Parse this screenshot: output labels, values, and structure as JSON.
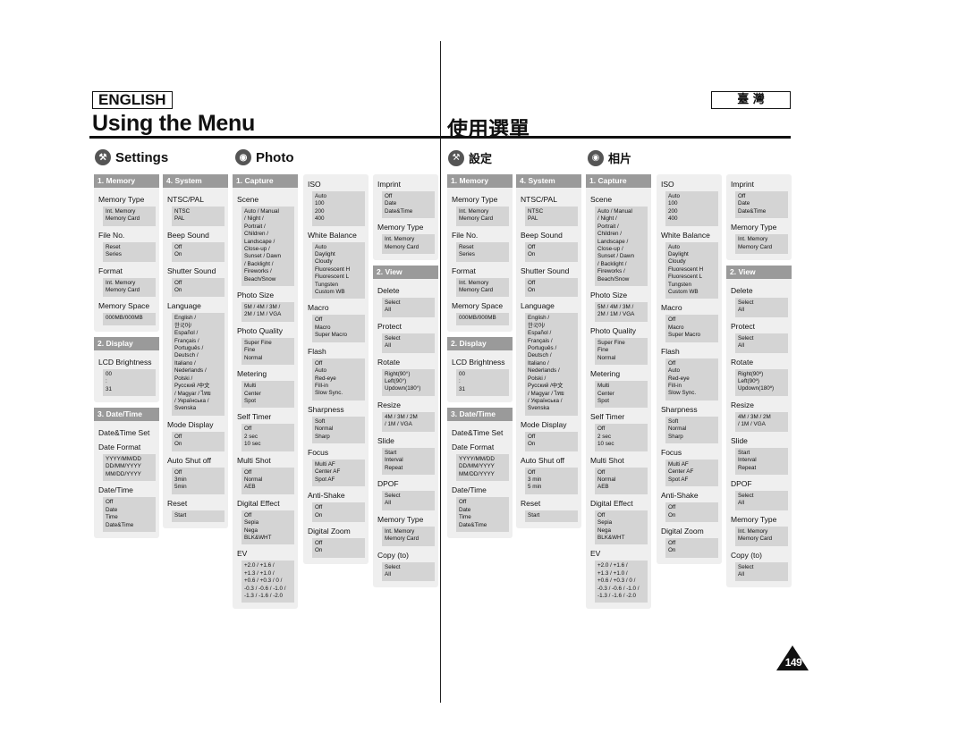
{
  "left": {
    "language_badge": "ENGLISH",
    "title": "Using the Menu",
    "settings_heading": "Settings",
    "photo_heading": "Photo",
    "columns": [
      {
        "panels": [
          {
            "head": "1. Memory",
            "items": [
              {
                "label": "Memory Type",
                "options": "Int. Memory\nMemory Card"
              },
              {
                "label": "File No.",
                "options": "Reset\nSeries"
              },
              {
                "label": "Format",
                "options": "Int. Memory\nMemory Card"
              },
              {
                "label": "Memory Space",
                "options": "000MB/000MB"
              }
            ]
          },
          {
            "head": "2. Display",
            "items": [
              {
                "label": "LCD Brightness",
                "options": "00\n:\n31"
              }
            ]
          },
          {
            "head": "3. Date/Time",
            "items": [
              {
                "label": "Date&Time Set",
                "options": null
              },
              {
                "label": "Date Format",
                "options": "YYYY/MM/DD\nDD/MM/YYYY\nMM/DD/YYYY"
              },
              {
                "label": "Date/Time",
                "options": "Off\nDate\nTime\nDate&Time"
              }
            ]
          }
        ]
      },
      {
        "panels": [
          {
            "head": "4. System",
            "items": [
              {
                "label": "NTSC/PAL",
                "options": "NTSC\nPAL"
              },
              {
                "label": "Beep Sound",
                "options": "Off\nOn"
              },
              {
                "label": "Shutter Sound",
                "options": "Off\nOn"
              },
              {
                "label": "Language",
                "options": "English /\n한국어/\nEspañol /\nFrançais /\nPortuguês /\nDeutsch /\nItaliano /\nNederlands /\nPolski /\nРусский /中文\n/ Magyar / ไทย\n/ Українська /\nSvenska"
              },
              {
                "label": "Mode Display",
                "options": "Off\nOn"
              },
              {
                "label": "Auto Shut off",
                "options": "Off\n3min\n5min"
              },
              {
                "label": "Reset",
                "options": "Start"
              }
            ]
          }
        ]
      },
      {
        "panels": [
          {
            "head": "1. Capture",
            "items": [
              {
                "label": "Scene",
                "options": "Auto / Manual\n/ Night /\nPortrait /\nChildren /\nLandscape /\nClose-up /\nSunset / Dawn\n/ Backlight /\nFireworks /\nBeach/Snow"
              },
              {
                "label": "Photo Size",
                "options": "5M / 4M / 3M /\n2M / 1M / VGA"
              },
              {
                "label": "Photo Quality",
                "options": "Super Fine\nFine\nNormal"
              },
              {
                "label": "Metering",
                "options": "Multi\nCenter\nSpot"
              },
              {
                "label": "Self Timer",
                "options": "Off\n2 sec\n10 sec"
              },
              {
                "label": "Multi Shot",
                "options": "Off\nNormal\nAEB"
              },
              {
                "label": "Digital Effect",
                "options": "Off\nSepia\nNega\nBLK&WHT"
              },
              {
                "label": "EV",
                "options": "+2.0 / +1.6 /\n+1.3 / +1.0 /\n+0.6 / +0.3 / 0 /\n-0.3 / -0.6 / -1.0 /\n-1.3 / -1.6 / -2.0"
              }
            ]
          }
        ]
      },
      {
        "panels": [
          {
            "head": null,
            "items": [
              {
                "label": "ISO",
                "options": "Auto\n100\n200\n400"
              },
              {
                "label": "White Balance",
                "options": "Auto\nDaylight\nCloudy\nFluorescent H\nFluorescent L\nTungsten\nCustom WB"
              },
              {
                "label": "Macro",
                "options": "Off\nMacro\nSuper Macro"
              },
              {
                "label": "Flash",
                "options": "Off\nAuto\nRed-eye\nFill-in\nSlow Sync."
              },
              {
                "label": "Sharpness",
                "options": "Soft\nNormal\nSharp"
              },
              {
                "label": "Focus",
                "options": "Multi AF\nCenter AF\nSpot AF"
              },
              {
                "label": "Anti-Shake",
                "options": "Off\nOn"
              },
              {
                "label": "Digital Zoom",
                "options": "Off\nOn"
              }
            ]
          }
        ]
      },
      {
        "panels": [
          {
            "head": null,
            "items": [
              {
                "label": "Imprint",
                "options": "Off\nDate\nDate&Time"
              },
              {
                "label": "Memory Type",
                "options": "Int. Memory\nMemory Card"
              }
            ]
          },
          {
            "head": "2. View",
            "items": [
              {
                "label": "Delete",
                "options": "Select\nAll"
              },
              {
                "label": "Protect",
                "options": "Select\nAll"
              },
              {
                "label": "Rotate",
                "options": "Right(90°)\nLeft(90°)\nUpdown(180°)"
              },
              {
                "label": "Resize",
                "options": "4M / 3M / 2M\n/ 1M / VGA"
              },
              {
                "label": "Slide",
                "options": "Start\nInterval\nRepeat"
              },
              {
                "label": "DPOF",
                "options": "Select\nAll"
              },
              {
                "label": "Memory Type",
                "options": "Int. Memory\nMemory Card"
              },
              {
                "label": "Copy (to)",
                "options": "Select\nAll"
              }
            ]
          }
        ]
      }
    ]
  },
  "right": {
    "language_badge": "臺 灣",
    "title": "使用選單",
    "settings_heading": "設定",
    "photo_heading": "相片",
    "columns": [
      {
        "panels": [
          {
            "head": "1. Memory",
            "items": [
              {
                "label": "Memory Type",
                "options": "Int. Memory\nMemory Card"
              },
              {
                "label": "File No.",
                "options": "Reset\nSeries"
              },
              {
                "label": "Format",
                "options": "Int. Memory\nMemory Card"
              },
              {
                "label": "Memory Space",
                "options": "000MB/000MB"
              }
            ]
          },
          {
            "head": "2. Display",
            "items": [
              {
                "label": "LCD Brightness",
                "options": "00\n:\n31"
              }
            ]
          },
          {
            "head": "3. Date/Time",
            "items": [
              {
                "label": "Date&Time Set",
                "options": null
              },
              {
                "label": "Date Format",
                "options": "YYYY/MM/DD\nDD/MM/YYYY\nMM/DD/YYYY"
              },
              {
                "label": "Date/Time",
                "options": "Off\nDate\nTime\nDate&Time"
              }
            ]
          }
        ]
      },
      {
        "panels": [
          {
            "head": "4. System",
            "items": [
              {
                "label": "NTSC/PAL",
                "options": "NTSC\nPAL"
              },
              {
                "label": "Beep Sound",
                "options": "Off\nOn"
              },
              {
                "label": "Shutter Sound",
                "options": "Off\nOn"
              },
              {
                "label": "Language",
                "options": "English /\n한국어/\nEspañol /\nFrançais /\nPortuguês /\nDeutsch /\nItaliano /\nNederlands /\nPolski /\nРусский /中文\n/ Magyar / ไทย\n/ Українська /\nSvenska"
              },
              {
                "label": "Mode Display",
                "options": "Off\nOn"
              },
              {
                "label": "Auto Shut off",
                "options": "Off\n3 min\n5 min"
              },
              {
                "label": "Reset",
                "options": "Start"
              }
            ]
          }
        ]
      },
      {
        "panels": [
          {
            "head": "1. Capture",
            "items": [
              {
                "label": "Scene",
                "options": "Auto / Manual\n/ Night /\nPortrait /\nChildren /\nLandscape /\nClose-up /\nSunset / Dawn\n/ Backlight /\nFireworks /\nBeach/Snow"
              },
              {
                "label": "Photo Size",
                "options": "5M / 4M / 3M /\n2M / 1M / VGA"
              },
              {
                "label": "Photo Quality",
                "options": "Super Fine\nFine\nNormal"
              },
              {
                "label": "Metering",
                "options": "Multi\nCenter\nSpot"
              },
              {
                "label": "Self Timer",
                "options": "Off\n2 sec\n10 sec"
              },
              {
                "label": "Multi Shot",
                "options": "Off\nNormal\nAEB"
              },
              {
                "label": "Digital Effect",
                "options": "Off\nSepia\nNega\nBLK&WHT"
              },
              {
                "label": "EV",
                "options": "+2.0 / +1.6 /\n+1.3 / +1.0 /\n+0.6 / +0.3 / 0 /\n-0.3 / -0.6 / -1.0 /\n-1.3 / -1.6 / -2.0"
              }
            ]
          }
        ]
      },
      {
        "panels": [
          {
            "head": null,
            "items": [
              {
                "label": "ISO",
                "options": "Auto\n100\n200\n400"
              },
              {
                "label": "White Balance",
                "options": "Auto\nDaylight\nCloudy\nFluorescent H\nFluorescent L\nTungsten\nCustom WB"
              },
              {
                "label": "Macro",
                "options": "Off\nMacro\nSuper Macro"
              },
              {
                "label": "Flash",
                "options": "Off\nAuto\nRed-eye\nFill-in\nSlow Sync."
              },
              {
                "label": "Sharpness",
                "options": "Soft\nNormal\nSharp"
              },
              {
                "label": "Focus",
                "options": "Multi AF\nCenter AF\nSpot AF"
              },
              {
                "label": "Anti-Shake",
                "options": "Off\nOn"
              },
              {
                "label": "Digital Zoom",
                "options": "Off\nOn"
              }
            ]
          }
        ]
      },
      {
        "panels": [
          {
            "head": null,
            "items": [
              {
                "label": "Imprint",
                "options": "Off\nDate\nDate&Time"
              },
              {
                "label": "Memory Type",
                "options": "Int. Memory\nMemory Card"
              }
            ]
          },
          {
            "head": "2. View",
            "items": [
              {
                "label": "Delete",
                "options": "Select\nAll"
              },
              {
                "label": "Protect",
                "options": "Select\nAll"
              },
              {
                "label": "Rotate",
                "options": "Right(90º)\nLeft(90º)\nUpdown(180º)"
              },
              {
                "label": "Resize",
                "options": "4M / 3M / 2M\n/ 1M / VGA"
              },
              {
                "label": "Slide",
                "options": "Start\nInterval\nRepeat"
              },
              {
                "label": "DPOF",
                "options": "Select\nAll"
              },
              {
                "label": "Memory Type",
                "options": "Int. Memory\nMemory Card"
              },
              {
                "label": "Copy (to)",
                "options": "Select\nAll"
              }
            ]
          }
        ]
      }
    ]
  },
  "page_number": "149",
  "icons": {
    "settings": "tools-icon",
    "photo": "camera-icon"
  }
}
